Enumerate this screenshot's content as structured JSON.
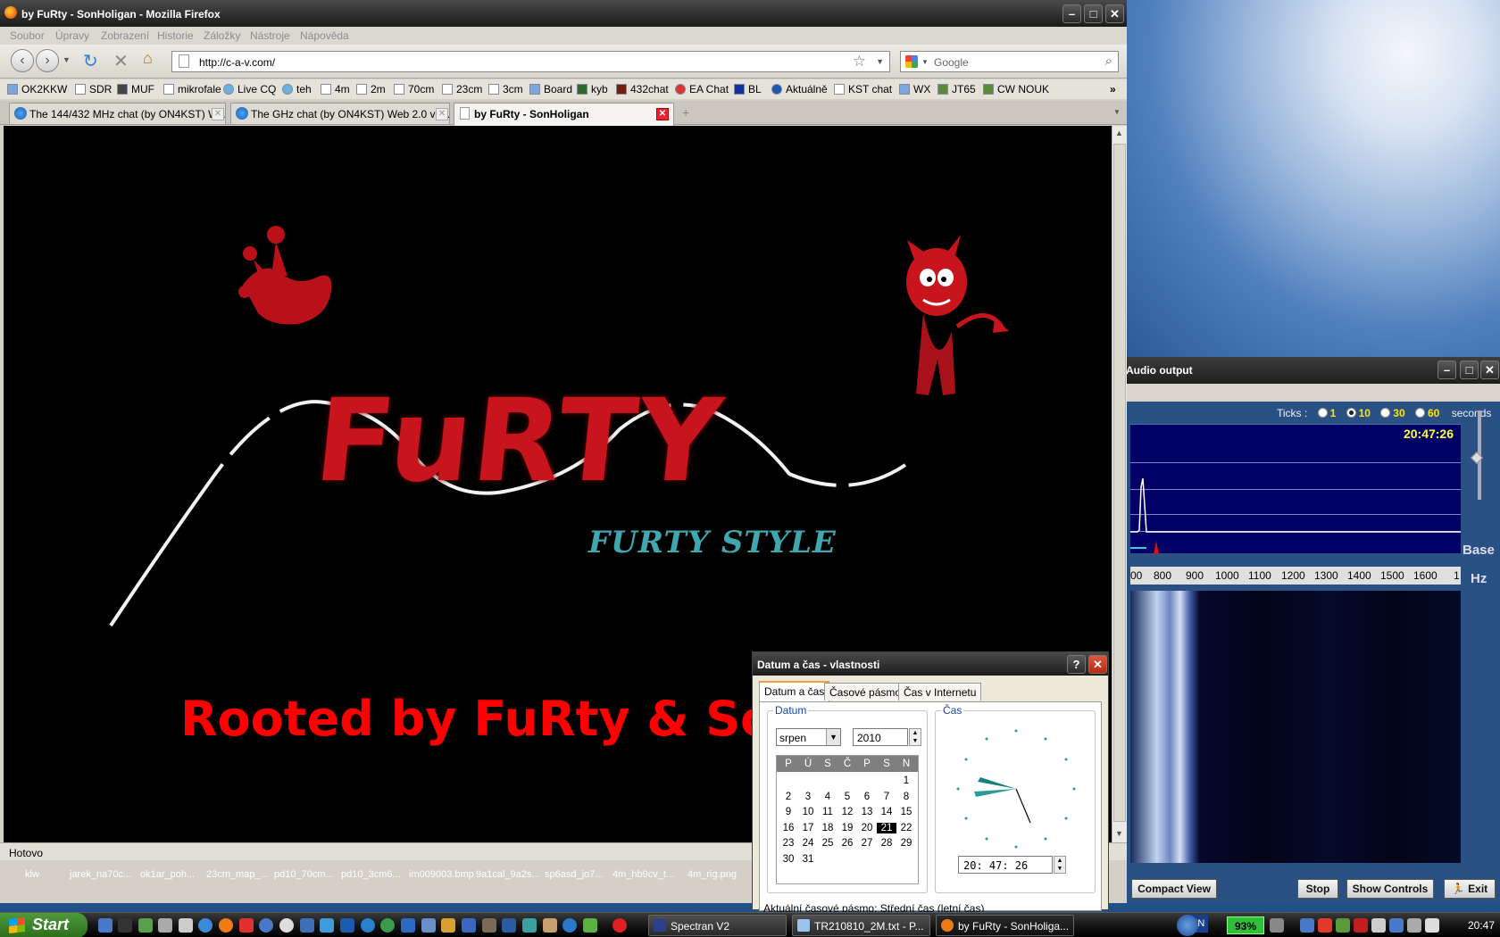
{
  "firefox": {
    "title": "by FuRty - SonHoligan - Mozilla Firefox",
    "menu": [
      "Soubor",
      "Úpravy",
      "Zobrazení",
      "Historie",
      "Záložky",
      "Nástroje",
      "Nápověda"
    ],
    "url": "http://c-a-v.com/",
    "search_placeholder": "Google",
    "bookmarks": [
      "OK2KKW",
      "SDR",
      "MUF",
      "mikrofale",
      "Live CQ",
      "teh",
      "4m",
      "2m",
      "70cm",
      "23cm",
      "3cm",
      "Board",
      "kyb",
      "432chat",
      "EA Chat",
      "BL",
      "Aktuálně",
      "KST chat",
      "WX",
      "JT65",
      "CW NOUK"
    ],
    "tabs": [
      {
        "label": "The 144/432 MHz chat (by ON4KST) W..."
      },
      {
        "label": "The GHz chat (by ON4KST) Web 2.0 ve..."
      },
      {
        "label": "by FuRty - SonHoligan"
      }
    ],
    "status": "Hotovo"
  },
  "page": {
    "logo_text": "FuRTY",
    "logo_sub": "FURTY STYLE",
    "headline": "Rooted by FuRty & SonHoligan"
  },
  "spectran": {
    "title": "Audio output",
    "ticks_label": "Ticks :",
    "ticks": [
      "1",
      "10",
      "30",
      "60"
    ],
    "ticks_selected": "10",
    "ticks_unit": "seconds",
    "scope_time": "20:47:26",
    "freq_ticks": [
      "00",
      "800",
      "900",
      "1000",
      "1100",
      "1200",
      "1300",
      "1400",
      "1500",
      "1600",
      "1"
    ],
    "base_label": "Base",
    "hz_label": "Hz",
    "buttons": {
      "compact": "Compact View",
      "stop": "Stop",
      "show_controls": "Show Controls",
      "exit": "Exit"
    }
  },
  "datetime_dialog": {
    "title": "Datum a čas - vlastnosti",
    "tabs": [
      "Datum a čas",
      "Časové pásmo",
      "Čas v Internetu"
    ],
    "date_group": "Datum",
    "time_group": "Čas",
    "month": "srpen",
    "year": "2010",
    "weekdays": [
      "P",
      "Ú",
      "S",
      "Č",
      "P",
      "S",
      "N"
    ],
    "days": [
      "1",
      "2",
      "3",
      "4",
      "5",
      "6",
      "7",
      "8",
      "9",
      "10",
      "11",
      "12",
      "13",
      "14",
      "15",
      "16",
      "17",
      "18",
      "19",
      "20",
      "21",
      "22",
      "23",
      "24",
      "25",
      "26",
      "27",
      "28",
      "29",
      "30",
      "31"
    ],
    "selected_day": "21",
    "time": "20: 47: 26",
    "timezone_label": "Aktuální časové pásmo:",
    "timezone_value": "Střední čas (letní čas)"
  },
  "desktop_files": [
    "klw",
    "jarek_na70c...",
    "ok1ar_poh...",
    "23cm_map_...",
    "pd10_70cm...",
    "pd10_3cm6...",
    "im009003.bmp",
    "9a1cal_9a2s...",
    "sp6asd_jo7...",
    "4m_hb9cv_t...",
    "4m_rig.png"
  ],
  "taskbar": {
    "start": "Start",
    "tasks": [
      "Spectran V2",
      "TR210810_2M.txt - P...",
      "by FuRty - SonHoliga..."
    ],
    "lang": "EN",
    "battery": "93%",
    "clock": "20:47"
  },
  "colors": {
    "headline": "#ff0000",
    "logo": "#c8141c",
    "logo_sub": "#3fa7ad",
    "scope_bg": "#000066",
    "scope_time": "#ffff30"
  }
}
